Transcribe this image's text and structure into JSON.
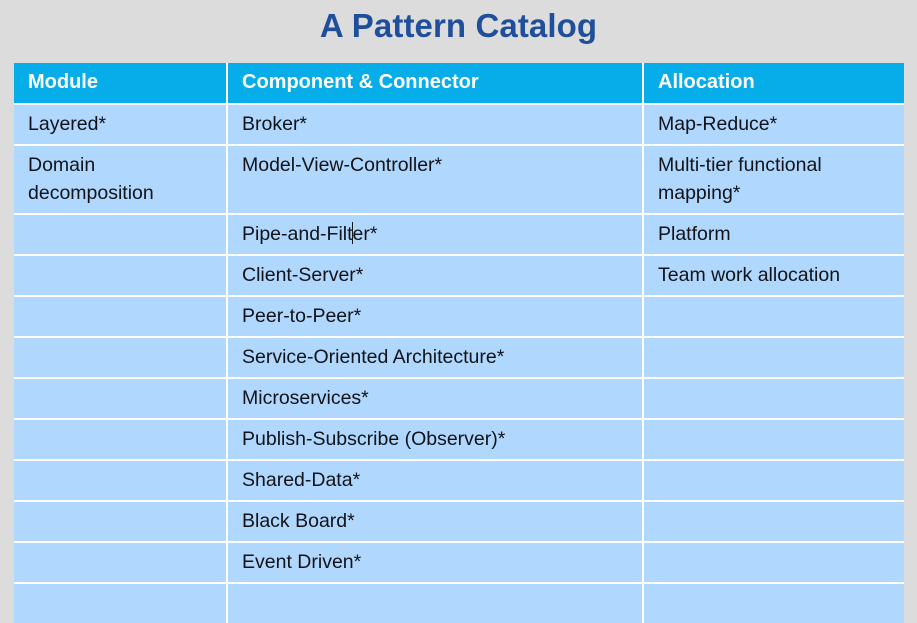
{
  "slide": {
    "title": "A Pattern Catalog",
    "title_color": "#1f4e9c",
    "background_color": "#dcdcdc"
  },
  "table": {
    "header_bg": "#06ade9",
    "header_text_color": "#ffffff",
    "cell_bg": "#b0d7fd",
    "grid_color": "#ffffff",
    "columns": [
      {
        "key": "module",
        "label": "Module"
      },
      {
        "key": "cc",
        "label": "Component & Connector"
      },
      {
        "key": "allocation",
        "label": "Allocation"
      }
    ],
    "rows": [
      {
        "module": "Layered*",
        "cc": "Broker*",
        "allocation": "Map-Reduce*"
      },
      {
        "module": "Domain decomposition",
        "cc": "Model-View-Controller*",
        "allocation": "Multi-tier functional mapping*"
      },
      {
        "module": "",
        "cc_before_caret": "Pipe-and-Filt",
        "cc_after_caret": "er*",
        "cc": "Pipe-and-Filter*",
        "allocation": "Platform"
      },
      {
        "module": "",
        "cc": "Client-Server*",
        "allocation": "Team work allocation"
      },
      {
        "module": "",
        "cc": "Peer-to-Peer*",
        "allocation": ""
      },
      {
        "module": "",
        "cc": "Service-Oriented Architecture*",
        "allocation": ""
      },
      {
        "module": "",
        "cc": "Microservices*",
        "allocation": ""
      },
      {
        "module": "",
        "cc": "Publish-Subscribe (Observer)*",
        "allocation": ""
      },
      {
        "module": "",
        "cc": "Shared-Data*",
        "allocation": ""
      },
      {
        "module": "",
        "cc": "Black Board*",
        "allocation": ""
      },
      {
        "module": "",
        "cc": "Event Driven*",
        "allocation": ""
      },
      {
        "module": "",
        "cc": "",
        "allocation": ""
      }
    ]
  },
  "caret": {
    "row_index": 2,
    "column": "cc",
    "description": "text-insertion-caret"
  }
}
